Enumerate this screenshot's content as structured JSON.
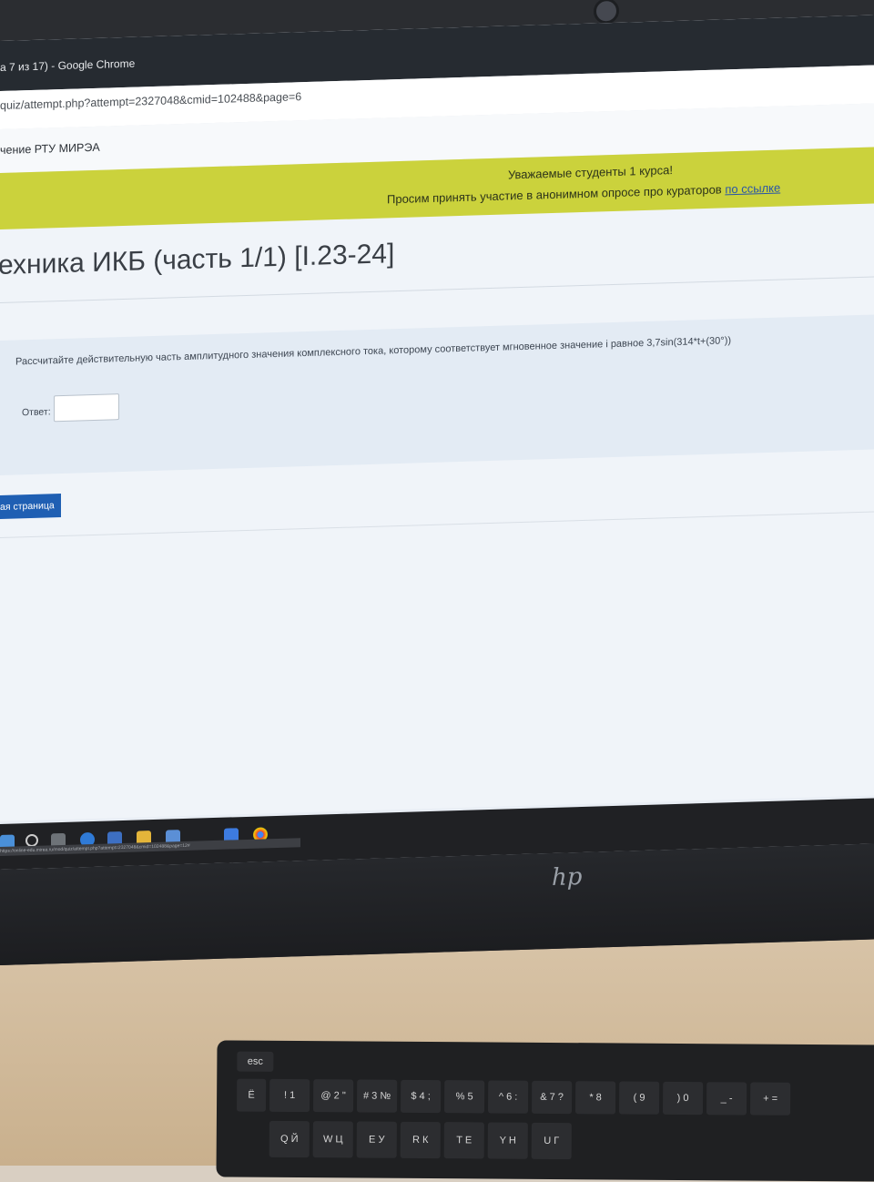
{
  "browser": {
    "window_title": "а 7 из 17) - Google Chrome",
    "url": "quiz/attempt.php?attempt=2327048&cmid=102488&page=6",
    "status_url": "https://online-edu.mirea.ru/mod/quiz/attempt.php?attempt=2327048&cmid=102488&page=12#"
  },
  "site": {
    "name": "чение РТУ МИРЭА"
  },
  "notice": {
    "line1": "Уважаемые студенты 1 курса!",
    "line2": "Просим принять участие в анонимном опросе про кураторов",
    "link": "по ссылке"
  },
  "course": {
    "title": "ехника ИКБ (часть 1/1) [I.23-24]"
  },
  "question": {
    "text": "Рассчитайте действительную часть амплитудного значения комплексного тока, которому соответствует  мгновенное значение i равное 3,7sin(314*t+(30°))",
    "answer_label": "Ответ:",
    "answer_value": ""
  },
  "navigation": {
    "next_label": "ая страница"
  },
  "taskbar": {
    "icons": [
      "windows-start-icon",
      "search-icon",
      "task-view-icon",
      "edge-icon",
      "store-icon",
      "file-explorer-icon",
      "mail-icon",
      "chrome-icon"
    ]
  },
  "device": {
    "brand": "hp"
  },
  "keyboard": {
    "keys": [
      "esc",
      "Ё",
      "! 1",
      "@ 2 \"",
      "# 3 №",
      "$ 4 ;",
      "% 5",
      "^ 6 :",
      "& 7 ?",
      "* 8",
      "( 9",
      ") 0",
      "_ -",
      "+ =",
      "Q Й",
      "W Ц",
      "E У",
      "R К",
      "T Е",
      "Y Н",
      "U Г"
    ]
  }
}
